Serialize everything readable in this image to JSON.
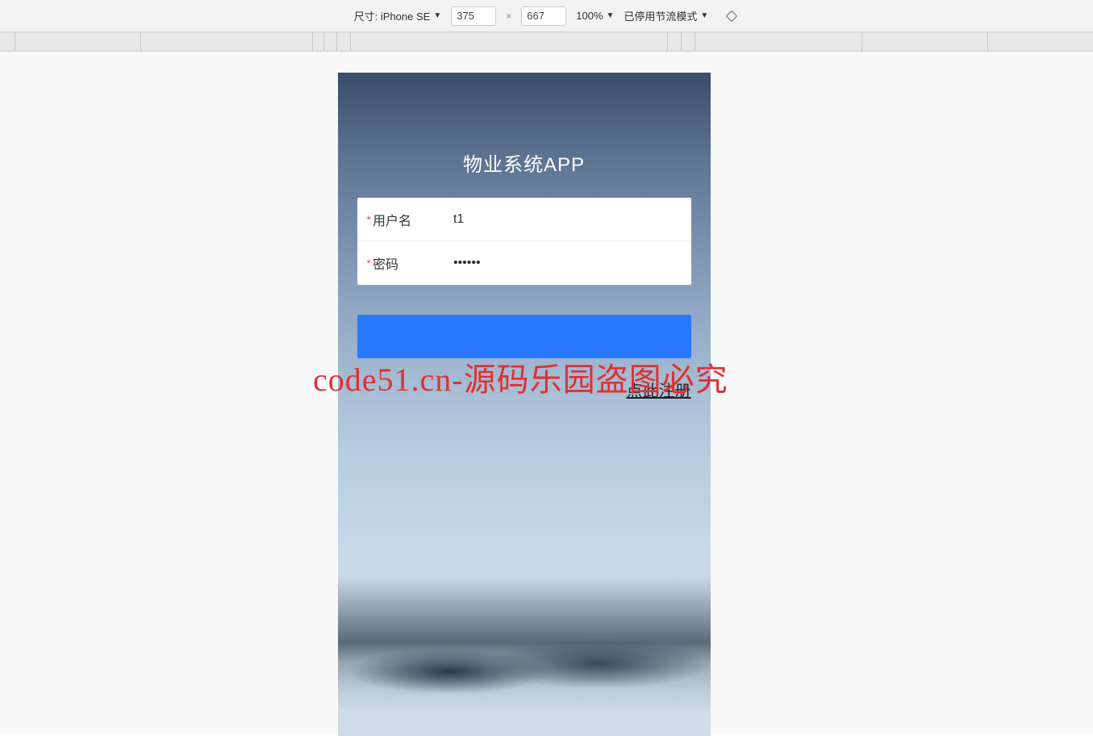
{
  "devtools": {
    "size_label": "尺寸: iPhone SE",
    "width": "375",
    "height": "667",
    "zoom": "100%",
    "throttle": "已停用节流模式"
  },
  "app": {
    "title": "物业系统APP",
    "username_label": "用户名",
    "username_value": "t1",
    "password_label": "密码",
    "password_value": "••••••",
    "register_link": "点此注册"
  },
  "watermark": "code51.cn-源码乐园盗图必究"
}
